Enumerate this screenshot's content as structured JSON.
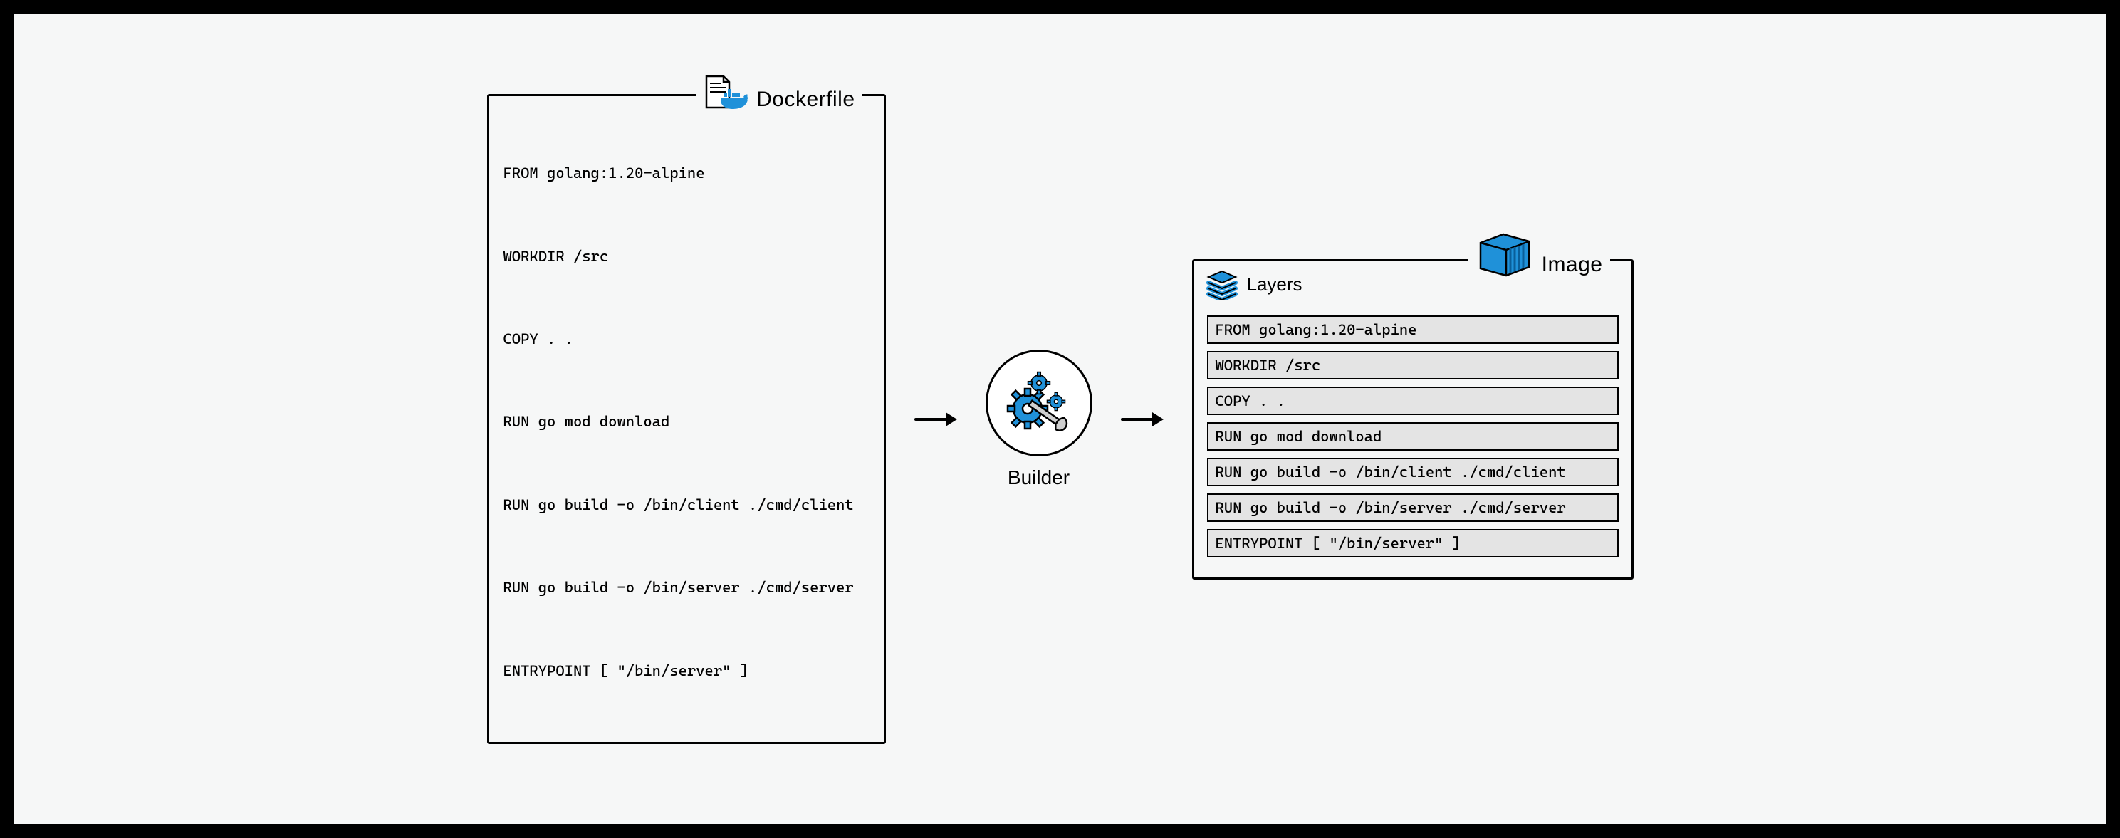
{
  "dockerfile": {
    "title": "Dockerfile",
    "lines": [
      "FROM golang:1.20-alpine",
      "WORKDIR /src",
      "COPY . .",
      "RUN go mod download",
      "RUN go build -o /bin/client ./cmd/client",
      "RUN go build -o /bin/server ./cmd/server",
      "ENTRYPOINT [ \"/bin/server\" ]"
    ]
  },
  "builder": {
    "label": "Builder"
  },
  "image": {
    "title": "Image",
    "layers_label": "Layers",
    "layers": [
      "FROM golang:1.20-alpine",
      "WORKDIR /src",
      "COPY . .",
      "RUN go mod download",
      "RUN go build -o /bin/client ./cmd/client",
      "RUN go build -o /bin/server ./cmd/server",
      "ENTRYPOINT [ \"/bin/server\" ]"
    ]
  },
  "colors": {
    "docker_blue": "#1f91d9",
    "layer_fill": "#e4e4e4"
  }
}
